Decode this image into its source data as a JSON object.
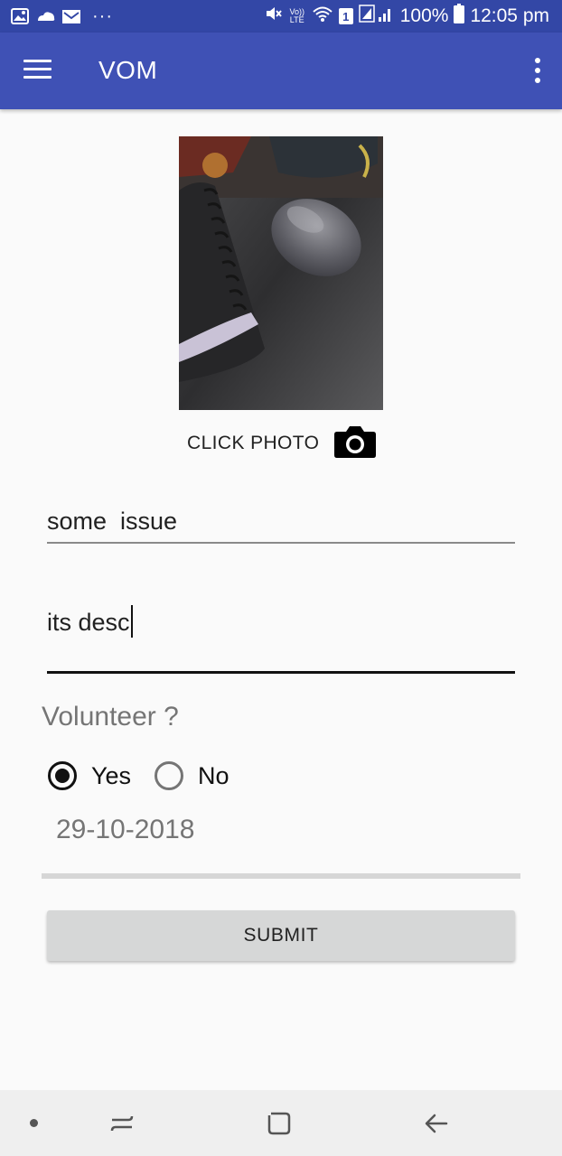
{
  "status_bar": {
    "battery": "100%",
    "time": "12:05 pm",
    "volte": "Vo)) LTE",
    "sim": "1",
    "left_icons": [
      "gallery-icon",
      "weather-icon",
      "mail-icon"
    ],
    "right_icons": [
      "mute-icon",
      "volte-icon",
      "wifi-icon",
      "signal-icon",
      "battery-icon"
    ]
  },
  "app_bar": {
    "title": "VOM",
    "background": "#3f51b5",
    "status_background": "#3347a6"
  },
  "photo": {
    "action_label": "CLICK PHOTO"
  },
  "form": {
    "title_value": "some  issue",
    "description_value": "its desc",
    "volunteer_label": "Volunteer ?",
    "options": {
      "yes": "Yes",
      "no": "No",
      "selected": "Yes"
    },
    "date": "29-10-2018",
    "submit_label": "SUBMIT"
  },
  "nav_bar": {
    "items": [
      "dot-icon",
      "recents-icon",
      "home-icon",
      "back-icon"
    ]
  }
}
